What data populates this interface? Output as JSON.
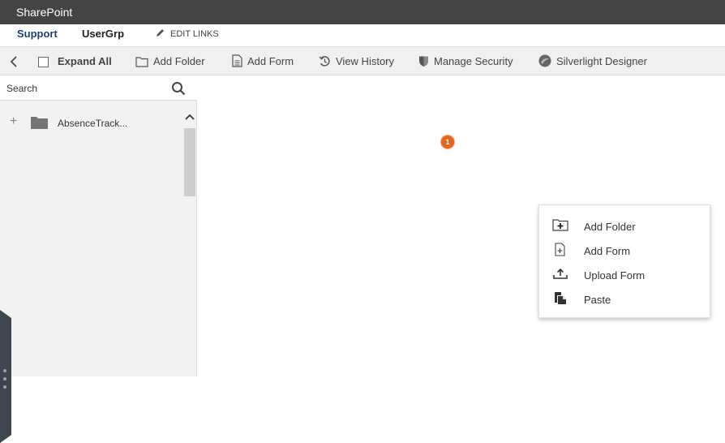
{
  "app": {
    "title": "SharePoint"
  },
  "nav": {
    "links": [
      {
        "label": "Support"
      },
      {
        "label": "UserGrp"
      }
    ],
    "edit_links": "EDIT LINKS"
  },
  "toolbar": {
    "expand_all": "Expand All",
    "add_folder": "Add Folder",
    "add_form": "Add Form",
    "view_history": "View History",
    "manage_security": "Manage Security",
    "silverlight_designer": "Silverlight Designer"
  },
  "sidebar": {
    "search": {
      "placeholder": "Search"
    },
    "tree": [
      {
        "label": "AbsenceTrack..."
      }
    ]
  },
  "main": {
    "badge": "1"
  },
  "context_menu": {
    "items": [
      {
        "label": "Add Folder"
      },
      {
        "label": "Add Form"
      },
      {
        "label": "Upload Form"
      },
      {
        "label": "Paste"
      }
    ]
  },
  "colors": {
    "topbar": "#444444",
    "active_link": "#1f3f6e",
    "badge": "#e8641b",
    "toolbar_bg": "#f0f0f0"
  }
}
